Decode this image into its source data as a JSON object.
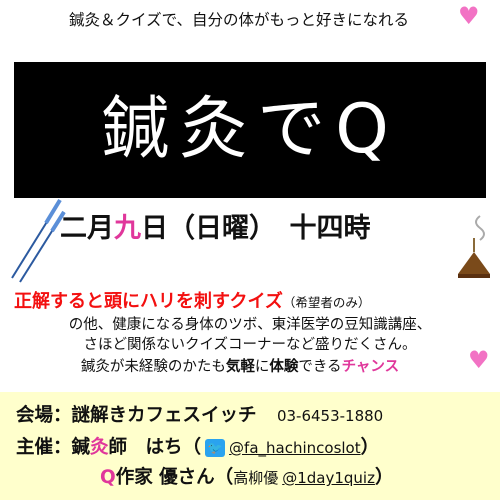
{
  "tagline": "鍼灸＆クイズで、自分の体がもっと好きになれる",
  "heart_glyph": "♥",
  "title": "鍼灸でQ",
  "date": {
    "part1": "二月",
    "day": "九",
    "part2": "日（日曜）　十四時"
  },
  "headline": {
    "main": "正解すると頭にハリを刺すクイズ",
    "note": "（希望者のみ）"
  },
  "desc_line1": "の他、健康になる身体のツボ、東洋医学の豆知識講座、",
  "desc_line2": "さほど関係ないクイズコーナーなど盛りだくさん。",
  "desc_line3": {
    "a": "鍼灸が未経験のかたも",
    "b": "気軽",
    "c": "に",
    "d": "体験",
    "e": "できる",
    "f": "チャンス"
  },
  "venue": {
    "label": "会場：謎解きカフェスイッチ",
    "phone": "03-6453-1880"
  },
  "host": {
    "label": "主催：鍼",
    "kyu": "灸",
    "label2": "師　はち（",
    "handle": "@fa_hachincoslot",
    "close": "）"
  },
  "writer": {
    "q": "Q",
    "label": "作家 優さん（",
    "name": "高柳優",
    "handle": "@1day1quiz",
    "close": "）"
  },
  "colors": {
    "accent_pink": "#e0379b",
    "heart_pink": "#f272c4",
    "headline_red": "#f31010",
    "info_bg": "#ffffcc",
    "twitter": "#2aa3ef"
  },
  "icons": [
    "needle-icon",
    "incense-icon",
    "twitter-icon",
    "heart-icon"
  ]
}
